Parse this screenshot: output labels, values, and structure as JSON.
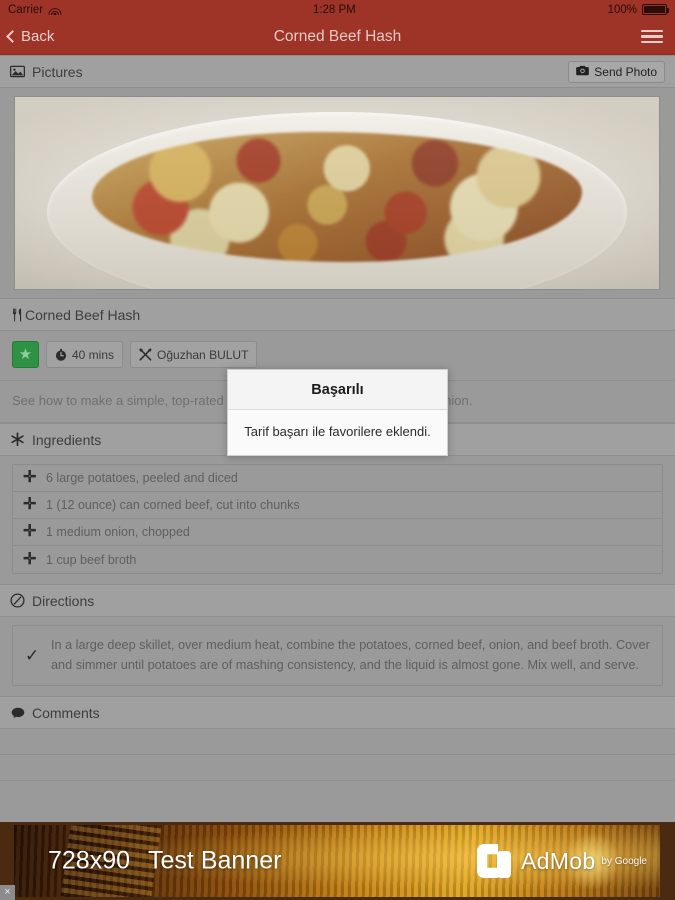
{
  "status_bar": {
    "carrier": "Carrier",
    "wifi_icon": "wifi-icon",
    "time": "1:28 PM",
    "battery_percent": "100%",
    "battery_icon": "battery-full-icon"
  },
  "navbar": {
    "back_label": "Back",
    "back_icon": "chevron-left-icon",
    "title": "Corned Beef Hash",
    "menu_icon": "hamburger-menu-icon",
    "color": "#9e3328"
  },
  "pictures_section": {
    "icon": "picture-icon",
    "label": "Pictures",
    "send_photo_label": "Send Photo",
    "send_photo_icon": "camera-icon"
  },
  "recipe": {
    "title_icon": "fork-knife-icon",
    "title": "Corned Beef Hash",
    "favorite_icon": "star-icon",
    "favorite_color": "#2e9144",
    "time_icon": "clock-icon",
    "time_label": "40 mins",
    "author_icon": "crossed-utensils-icon",
    "author_label": "Oğuzhan BULUT",
    "description": "See how to make a simple, top-rated corned beef hash with potatoes and onion."
  },
  "ingredients_section": {
    "icon": "asterisk-icon",
    "label": "Ingredients",
    "add_icon": "plus-icon",
    "items": [
      "6 large potatoes, peeled and diced",
      "1 (12 ounce) can corned beef, cut into chunks",
      "1 medium onion, chopped",
      "1 cup beef broth"
    ]
  },
  "directions_section": {
    "icon": "clock-outline-icon",
    "label": "Directions",
    "check_icon": "check-icon",
    "steps": [
      "In a large deep skillet, over medium heat, combine the potatoes, corned beef, onion, and beef broth. Cover and simmer until potatoes are of mashing consistency, and the liquid is almost gone. Mix well, and serve."
    ]
  },
  "comments_section": {
    "icon": "comment-icon",
    "label": "Comments"
  },
  "dialog": {
    "title": "Başarılı",
    "message": "Tarif başarı ile favorilere eklendi."
  },
  "ad_banner": {
    "size_label": "728x90",
    "test_label": "Test Banner",
    "brand": "AdMob",
    "brand_suffix": "by Google",
    "close_label": "×",
    "logo_icon": "admob-logo-icon"
  }
}
